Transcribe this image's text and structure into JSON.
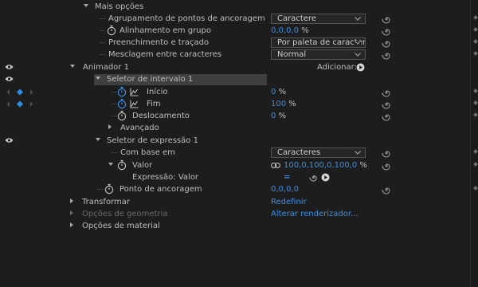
{
  "rows": {
    "mais_opcoes": "Mais opções",
    "agrupamento": {
      "label": "Agrupamento de pontos de ancoragem",
      "value": "Caractere"
    },
    "alinhamento": {
      "label": "Alinhamento em grupo",
      "value": "0,0,0,0",
      "unit": "%"
    },
    "preenchimento": {
      "label": "Preenchimento e traçado",
      "value": "Por paleta de caractere"
    },
    "mesclagem": {
      "label": "Mesclagem entre caracteres",
      "value": "Normal"
    },
    "animador": {
      "label": "Animador 1",
      "adicionar": "Adicionar:"
    },
    "seletor_intervalo": "Seletor de intervalo 1",
    "inicio": {
      "label": "Início",
      "value": "0",
      "unit": "%"
    },
    "fim": {
      "label": "Fim",
      "value": "100",
      "unit": "%"
    },
    "deslocamento": {
      "label": "Deslocamento",
      "value": "0",
      "unit": "%"
    },
    "avancado": "Avançado",
    "seletor_expressao": "Seletor de expressão 1",
    "com_base": {
      "label": "Com base em",
      "value": "Caracteres"
    },
    "valor": {
      "label": "Valor",
      "value": "100,0,100,0,100,0",
      "unit": "%"
    },
    "expressao": {
      "label": "Expressão: Valor",
      "equals": "="
    },
    "ponto": {
      "label": "Ponto de ancoragem",
      "value": "0,0,0,0"
    },
    "transformar": {
      "label": "Transformar",
      "action": "Redefinir"
    },
    "geometria": {
      "label": "Opções de geometria",
      "action": "Alterar renderizador..."
    },
    "material": "Opções de material"
  },
  "colors": {
    "link": "#3b8ee4",
    "keyframe": "#2f8fe8",
    "selected_row": "#3f3f3f",
    "background": "#1d1d1d"
  },
  "icons": [
    "eye-icon",
    "stopwatch-icon",
    "graph-icon",
    "spiral-link-icon",
    "play-circle-icon",
    "chain-link-icon",
    "keyframe-diamond-icon",
    "chevron-down-icon"
  ]
}
